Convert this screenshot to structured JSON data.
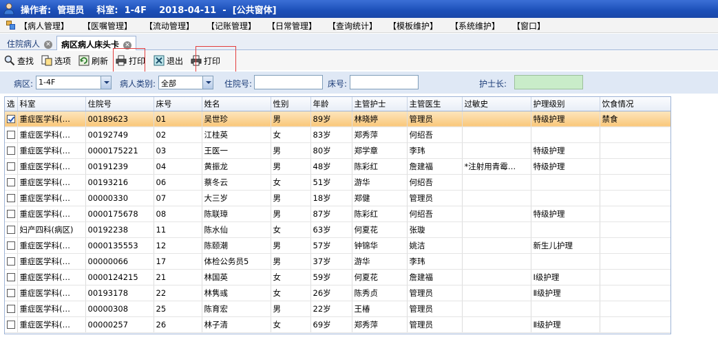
{
  "window": {
    "title": "操作者:  管理员    科室:  1-4F    2018-04-11  -  [公共窗体]"
  },
  "menu": [
    {
      "label": "【病人管理】"
    },
    {
      "label": "【医嘱管理】"
    },
    {
      "label": "【流动管理】"
    },
    {
      "label": "【记账管理】"
    },
    {
      "label": "【日常管理】"
    },
    {
      "label": "【查询统计】"
    },
    {
      "label": "【模板维护】"
    },
    {
      "label": "【系统维护】"
    },
    {
      "label": "【窗口】"
    }
  ],
  "tabs": [
    {
      "label": "住院病人",
      "active": false
    },
    {
      "label": "病区病人床头卡",
      "active": true
    }
  ],
  "toolbar": {
    "search": "查找",
    "options": "选项",
    "refresh": "刷新",
    "print1": "打印",
    "exit": "退出",
    "print2": "打印"
  },
  "filters": {
    "ward_label": "病区:",
    "ward_value": "1-4F",
    "type_label": "病人类别:",
    "type_value": "全部",
    "admission_label": "住院号:",
    "admission_value": "",
    "bed_label": "床号:",
    "bed_value": "",
    "headnurse_label": "护士长:",
    "headnurse_value": ""
  },
  "table": {
    "columns": [
      "选",
      "科室",
      "住院号",
      "床号",
      "姓名",
      "性别",
      "年龄",
      "主管护士",
      "主管医生",
      "过敏史",
      "护理级别",
      "饮食情况"
    ],
    "rows": [
      {
        "checked": true,
        "cells": [
          "重症医学科(…",
          "00189623",
          "01",
          "吴世珍",
          "男",
          "89岁",
          "林晓婷",
          "管理员",
          "",
          "特级护理",
          "禁食"
        ]
      },
      {
        "checked": false,
        "cells": [
          "重症医学科(…",
          "00192749",
          "02",
          "江桂英",
          "女",
          "83岁",
          "郑秀萍",
          "何绍吾",
          "",
          "",
          ""
        ]
      },
      {
        "checked": false,
        "cells": [
          "重症医学科(…",
          "0000175221",
          "03",
          "王医一",
          "男",
          "80岁",
          "郑学章",
          "李玮",
          "",
          "特级护理",
          ""
        ]
      },
      {
        "checked": false,
        "cells": [
          "重症医学科(…",
          "00191239",
          "04",
          "黄振龙",
          "男",
          "48岁",
          "陈彩红",
          "詹建福",
          "*注射用青霉…",
          "特级护理",
          ""
        ]
      },
      {
        "checked": false,
        "cells": [
          "重症医学科(…",
          "00193216",
          "06",
          "蔡冬云",
          "女",
          "51岁",
          "游华",
          "何绍吾",
          "",
          "",
          ""
        ]
      },
      {
        "checked": false,
        "cells": [
          "重症医学科(…",
          "00000330",
          "07",
          "大三岁",
          "男",
          "18岁",
          "郑健",
          "管理员",
          "",
          "",
          ""
        ]
      },
      {
        "checked": false,
        "cells": [
          "重症医学科(…",
          "0000175678",
          "08",
          "陈联璋",
          "男",
          "87岁",
          "陈彩红",
          "何绍吾",
          "",
          "特级护理",
          ""
        ]
      },
      {
        "checked": false,
        "cells": [
          "妇产四科(病区)",
          "00192238",
          "11",
          "陈水仙",
          "女",
          "63岁",
          "何夏花",
          "张璇",
          "",
          "",
          ""
        ]
      },
      {
        "checked": false,
        "cells": [
          "重症医学科(…",
          "0000135553",
          "12",
          "陈颐潮",
          "男",
          "57岁",
          "钟锦华",
          "姚洁",
          "",
          "新生儿护理",
          ""
        ]
      },
      {
        "checked": false,
        "cells": [
          "重症医学科(…",
          "00000066",
          "17",
          "体检公务员5",
          "男",
          "37岁",
          "游华",
          "李玮",
          "",
          "",
          ""
        ]
      },
      {
        "checked": false,
        "cells": [
          "重症医学科(…",
          "0000124215",
          "21",
          "林国英",
          "女",
          "59岁",
          "何夏花",
          "詹建福",
          "",
          "Ⅰ级护理",
          ""
        ]
      },
      {
        "checked": false,
        "cells": [
          "重症医学科(…",
          "00193178",
          "22",
          "林隽彧",
          "女",
          "26岁",
          "陈秀贞",
          "管理员",
          "",
          "Ⅱ级护理",
          ""
        ]
      },
      {
        "checked": false,
        "cells": [
          "重症医学科(…",
          "00000308",
          "25",
          "陈育宏",
          "男",
          "22岁",
          "王椿",
          "管理员",
          "",
          "",
          ""
        ]
      },
      {
        "checked": false,
        "cells": [
          "重症医学科(…",
          "00000257",
          "26",
          "林子清",
          "女",
          "69岁",
          "郑秀萍",
          "管理员",
          "",
          "Ⅱ级护理",
          ""
        ]
      }
    ]
  }
}
